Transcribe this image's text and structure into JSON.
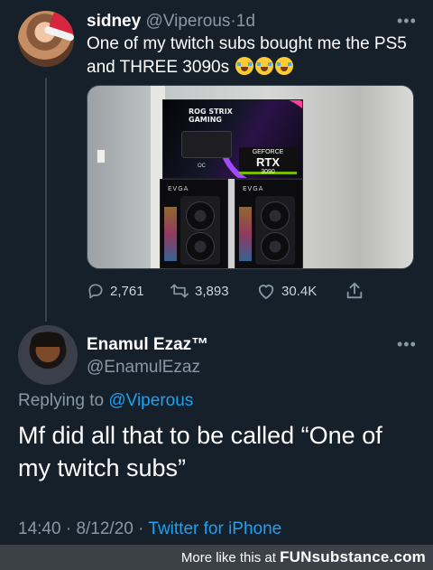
{
  "tweet": {
    "author_name": "sidney",
    "author_handle": "@Viperous",
    "separator": "·",
    "time_ago": "1d",
    "text": "One of my twitch subs bought me the PS5 and THREE 3090s",
    "emojis": [
      "loudly-crying-face",
      "loudly-crying-face",
      "loudly-crying-face"
    ],
    "photo": {
      "rog_brand": "ROG STRIX",
      "rog_sub": "GAMING",
      "rog_badge": "OC",
      "nvidia_label": "GEFORCE",
      "rtx_label": "RTX",
      "model_label": "3090",
      "evga_label_1": "EVGA",
      "evga_label_2": "EVGA"
    },
    "stats": {
      "replies": "2,761",
      "retweets": "3,893",
      "likes": "30.4K"
    }
  },
  "reply": {
    "author_name": "Enamul Ezaz™",
    "author_handle": "@EnamulEzaz",
    "replying_prefix": "Replying to ",
    "replying_to": "@Viperous",
    "text": "Mf did all that to be called “One of my twitch subs”",
    "time": "14:40",
    "separator": "·",
    "date": "8/12/20",
    "separator2": "·",
    "client": "Twitter for iPhone"
  },
  "watermark": {
    "prefix": "More like this at ",
    "brand": "FUNsubstance.com"
  },
  "colors": {
    "background": "#15202b",
    "secondary_text": "#8899a6",
    "link": "#1da1f2"
  }
}
